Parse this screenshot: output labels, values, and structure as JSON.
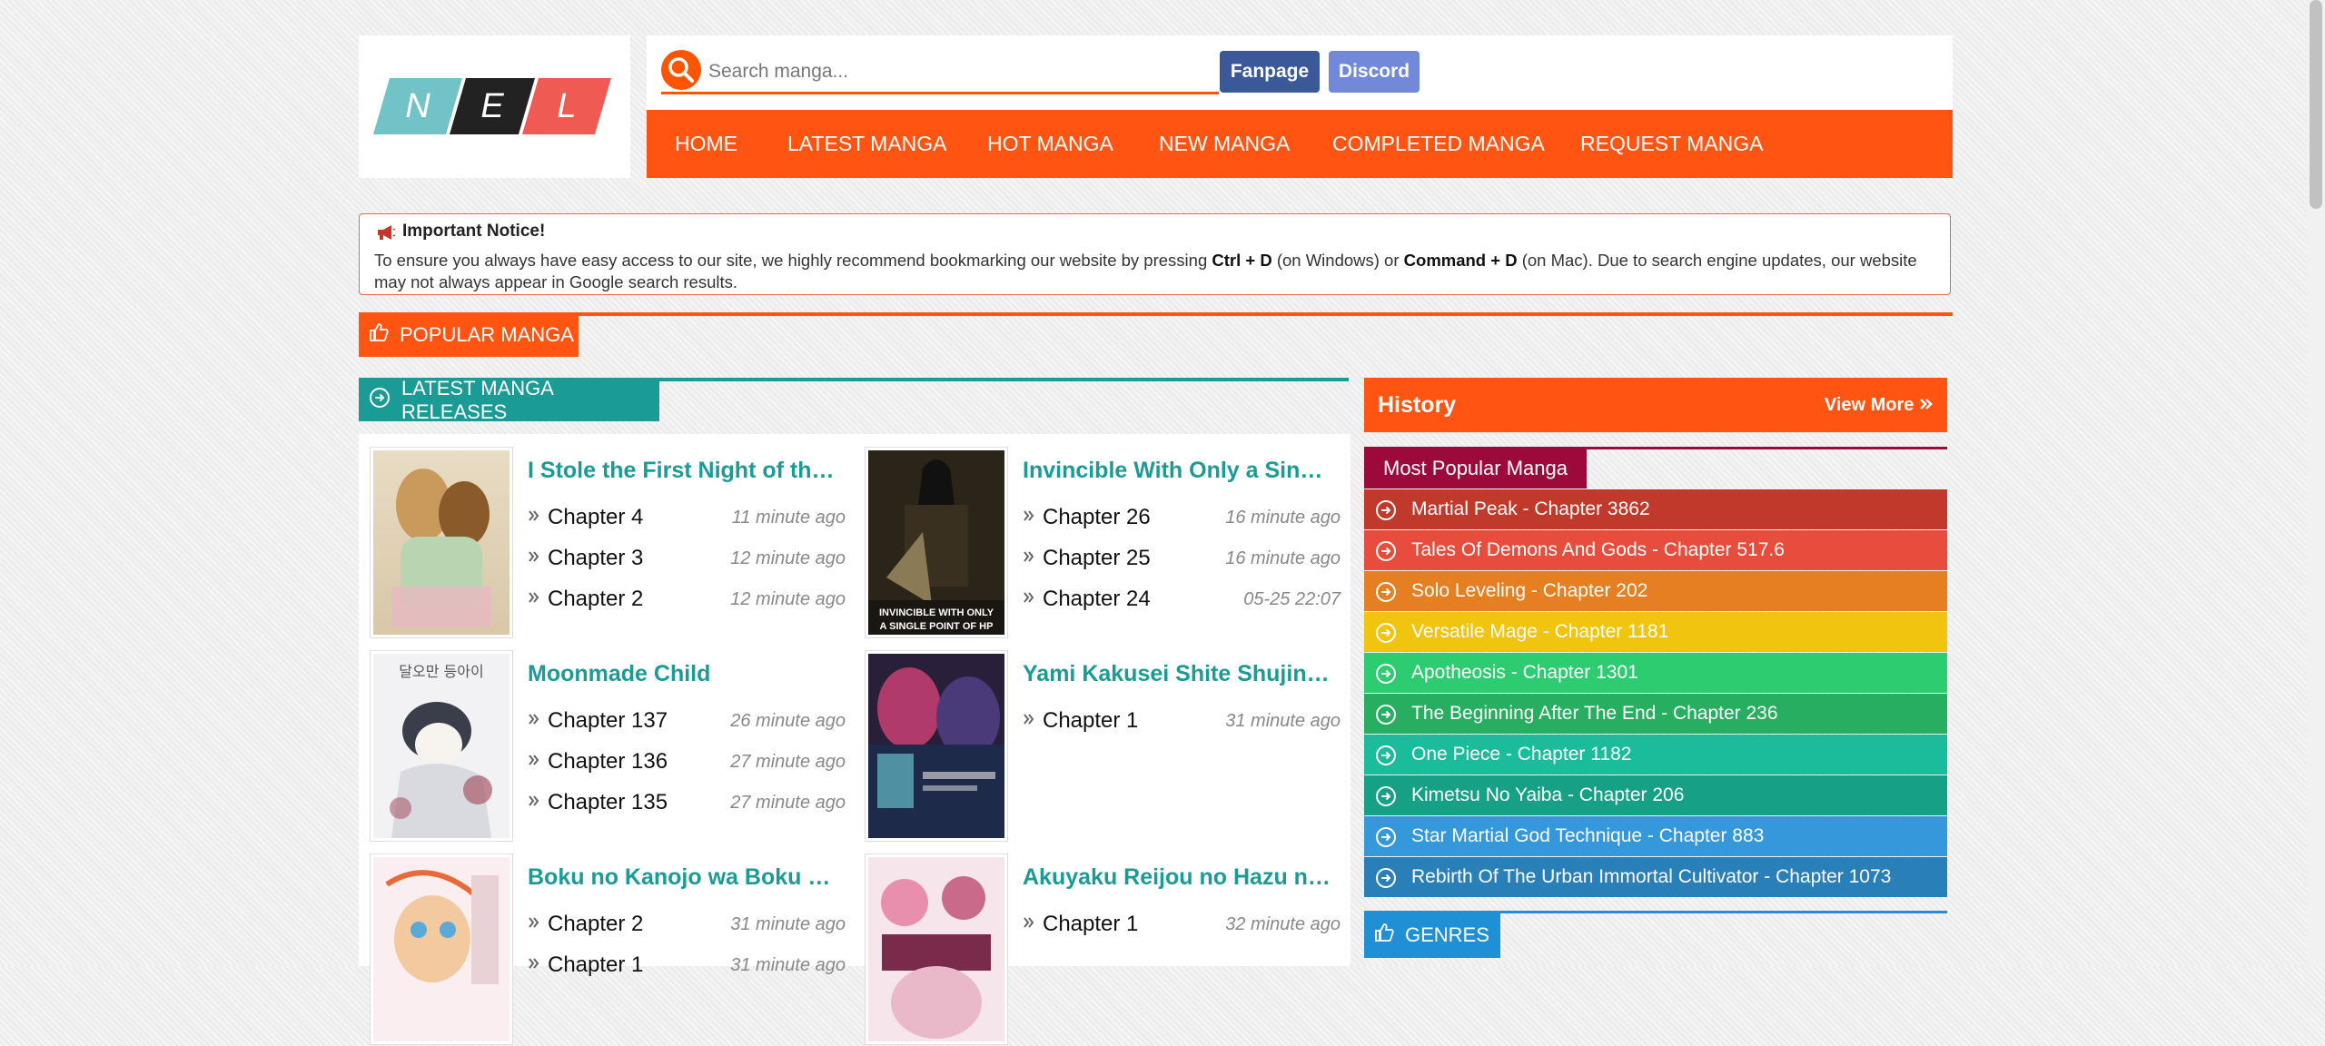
{
  "logo": {
    "letters": [
      "N",
      "E",
      "L"
    ]
  },
  "search": {
    "placeholder": "Search manga..."
  },
  "buttons": {
    "fanpage": "Fanpage",
    "discord": "Discord"
  },
  "nav": {
    "items": [
      "HOME",
      "LATEST MANGA",
      "HOT MANGA",
      "NEW MANGA",
      "COMPLETED MANGA",
      "REQUEST MANGA"
    ]
  },
  "notice": {
    "title": "Important Notice!",
    "text_1": "To ensure you always have easy access to our site, we highly recommend bookmarking our website by pressing ",
    "key_1": "Ctrl + D",
    "text_2": " (on Windows) or ",
    "key_2": "Command + D",
    "text_3": " (on Mac). Due to search engine updates, our website may not always appear in Google search results."
  },
  "sections": {
    "popular": "POPULAR MANGA",
    "latest": "LATEST MANGA RELEASES",
    "history": "History",
    "view_more": "View More",
    "most_popular": "Most Popular Manga",
    "genres": "GENRES"
  },
  "latest": [
    {
      "title": "I Stole the First Night of th…",
      "chapters": [
        {
          "label": "Chapter 4",
          "time": "11 minute ago"
        },
        {
          "label": "Chapter 3",
          "time": "12 minute ago"
        },
        {
          "label": "Chapter 2",
          "time": "12 minute ago"
        }
      ]
    },
    {
      "title": "Invincible With Only a Sin…",
      "chapters": [
        {
          "label": "Chapter 26",
          "time": "16 minute ago"
        },
        {
          "label": "Chapter 25",
          "time": "16 minute ago"
        },
        {
          "label": "Chapter 24",
          "time": "05-25 22:07"
        }
      ]
    },
    {
      "title": "Moonmade Child",
      "chapters": [
        {
          "label": "Chapter 137",
          "time": "26 minute ago"
        },
        {
          "label": "Chapter 136",
          "time": "27 minute ago"
        },
        {
          "label": "Chapter 135",
          "time": "27 minute ago"
        }
      ]
    },
    {
      "title": "Yami Kakusei Shite Shujin…",
      "chapters": [
        {
          "label": "Chapter 1",
          "time": "31 minute ago"
        }
      ]
    },
    {
      "title": "Boku no Kanojo wa Boku …",
      "chapters": [
        {
          "label": "Chapter 2",
          "time": "31 minute ago"
        },
        {
          "label": "Chapter 1",
          "time": "31 minute ago"
        }
      ]
    },
    {
      "title": "Akuyaku Reijou no Hazu n…",
      "chapters": [
        {
          "label": "Chapter 1",
          "time": "32 minute ago"
        }
      ]
    }
  ],
  "covers": {
    "c1": "INVINCIBLE WITH ONLY",
    "c2": "A SINGLE POINT OF HP",
    "m1": "달오만 등아이"
  },
  "most_popular": [
    {
      "label": "Martial Peak - Chapter 3862",
      "color": "#c0392b"
    },
    {
      "label": "Tales Of Demons And Gods - Chapter 517.6",
      "color": "#e74c3c"
    },
    {
      "label": "Solo Leveling - Chapter 202",
      "color": "#e67e22"
    },
    {
      "label": "Versatile Mage - Chapter 1181",
      "color": "#f1c40f"
    },
    {
      "label": "Apotheosis - Chapter 1301",
      "color": "#2ecc71"
    },
    {
      "label": "The Beginning After The End - Chapter 236",
      "color": "#27ae60"
    },
    {
      "label": "One Piece - Chapter 1182",
      "color": "#1abc9c"
    },
    {
      "label": "Kimetsu No Yaiba - Chapter 206",
      "color": "#16a085"
    },
    {
      "label": "Star Martial God Technique - Chapter 883",
      "color": "#3498db"
    },
    {
      "label": "Rebirth Of The Urban Immortal Cultivator - Chapter 1073",
      "color": "#2980b9"
    }
  ],
  "colors": {
    "accent": "#ff5412",
    "teal": "#1b9b96",
    "crimson": "#9c0a3c",
    "blue": "#1f8fd6"
  }
}
